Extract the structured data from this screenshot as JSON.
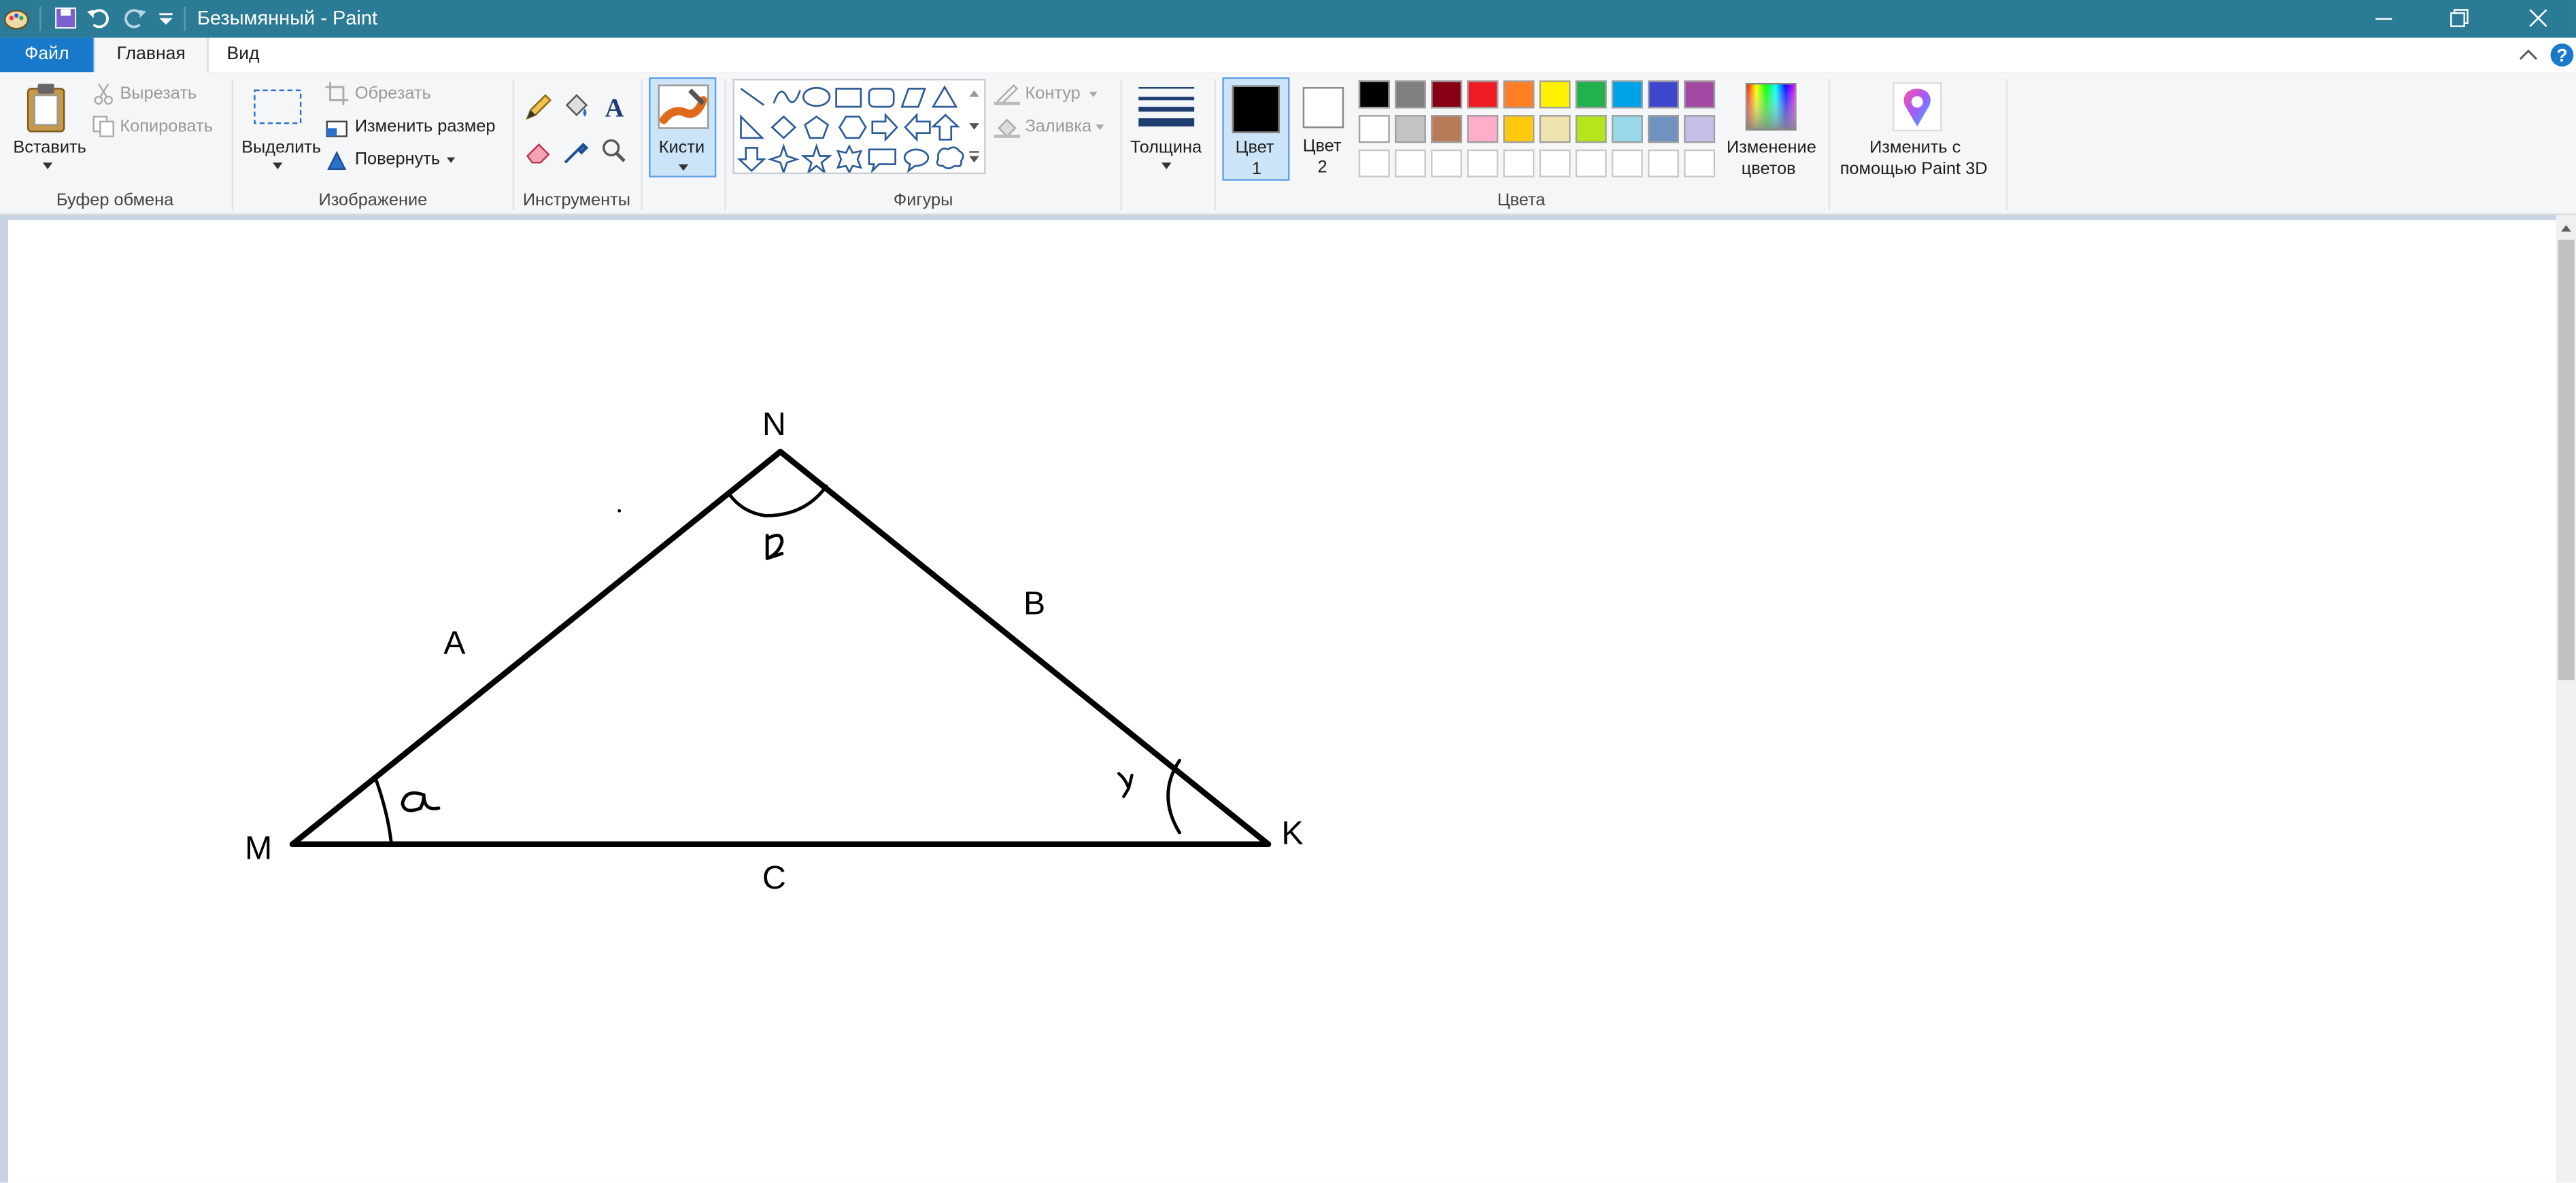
{
  "window": {
    "title": "Безымянный - Paint"
  },
  "tabs": {
    "file": "Файл",
    "home": "Главная",
    "view": "Вид"
  },
  "clipboard": {
    "paste": "Вставить",
    "cut": "Вырезать",
    "copy": "Копировать",
    "group": "Буфер обмена"
  },
  "image": {
    "select": "Выделить",
    "crop": "Обрезать",
    "resize": "Изменить размер",
    "rotate": "Повернуть",
    "group": "Изображение"
  },
  "tools": {
    "group": "Инструменты",
    "brushes": "Кисти"
  },
  "shapes": {
    "outline": "Контур",
    "fill": "Заливка",
    "group": "Фигуры"
  },
  "size": {
    "label": "Толщина"
  },
  "colors": {
    "color1_line1": "Цвет",
    "color1_line2": "1",
    "color2_line1": "Цвет",
    "color2_line2": "2",
    "edit_line1": "Изменение",
    "edit_line2": "цветов",
    "group": "Цвета",
    "color1_value": "#000000",
    "color2_value": "#ffffff",
    "palette_row1": [
      "#000000",
      "#7f7f7f",
      "#880015",
      "#ed1c24",
      "#ff7f27",
      "#fff200",
      "#22b14c",
      "#00a2e8",
      "#3f48cc",
      "#a349a4"
    ],
    "palette_row2": [
      "#ffffff",
      "#c3c3c3",
      "#b97a57",
      "#ffaec9",
      "#ffc90e",
      "#efe4b0",
      "#b5e61d",
      "#99d9ea",
      "#7092be",
      "#c8bfe7"
    ],
    "palette_row3": [
      "#ffffff",
      "#ffffff",
      "#ffffff",
      "#ffffff",
      "#ffffff",
      "#ffffff",
      "#ffffff",
      "#ffffff",
      "#ffffff",
      "#ffffff"
    ]
  },
  "paint3d": {
    "line1": "Изменить с",
    "line2": "помощью Paint 3D"
  },
  "drawing": {
    "vertex_n": "N",
    "vertex_m": "M",
    "vertex_k": "K",
    "side_a": "A",
    "side_b": "B",
    "side_c": "C"
  },
  "accent": "#1979ca",
  "titlebar_color": "#2b7a96"
}
